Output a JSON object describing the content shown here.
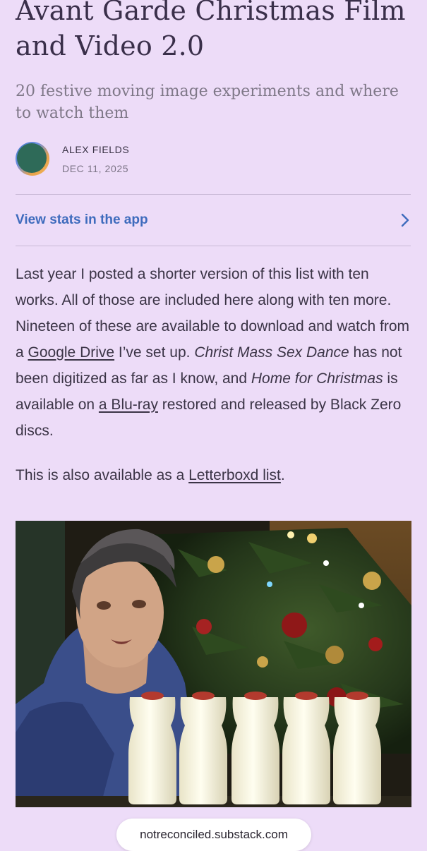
{
  "article": {
    "title": "Avant Garde Christmas Film and Video 2.0",
    "subtitle": "20 festive moving image experiments and where to watch them",
    "author": "ALEX FIELDS",
    "date": "DEC 11, 2025"
  },
  "stats_link": {
    "label": "View stats in the app",
    "icon": "chevron-right-icon"
  },
  "paragraph1": {
    "t1": "Last year I posted a shorter version of this list with ten works. All of those are included here along with ten more. Nineteen of these are available to download and watch from a ",
    "link1": "Google Drive",
    "t2": " I’ve set up. ",
    "italic1": "Christ Mass Sex Dance",
    "t3": " has not been digitized as far as I know, and ",
    "italic2": "Home for Christmas",
    "t4": " is available on ",
    "link2": "a Blu-ray",
    "t5": " restored and released by Black Zero discs."
  },
  "paragraph2": {
    "t1": "This is also available as a ",
    "link1": "Letterboxd list",
    "t2": "."
  },
  "browser": {
    "url": "notreconciled.substack.com"
  },
  "colors": {
    "background": "#eddcf8",
    "link_blue": "#3e6bbd",
    "text": "#3b3446"
  }
}
